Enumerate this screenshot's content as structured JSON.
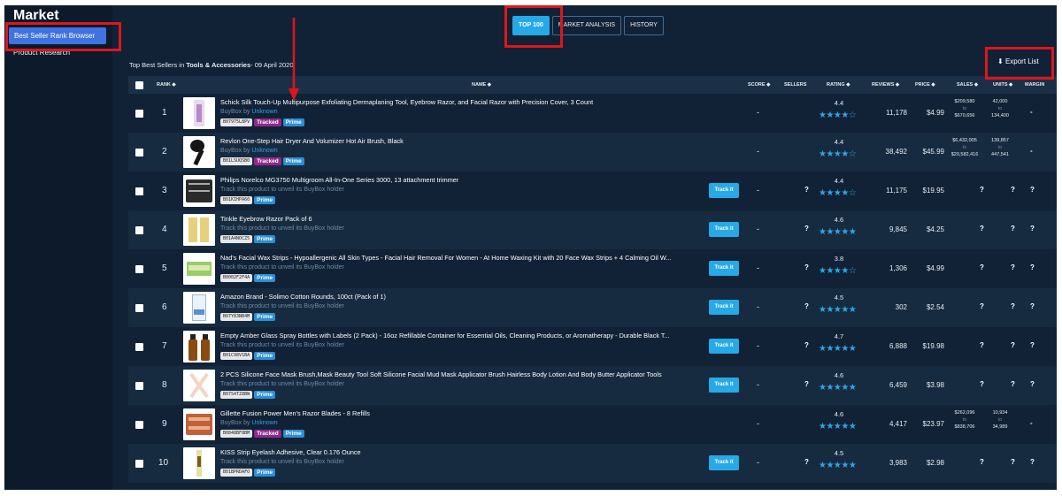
{
  "brand": "Market",
  "sidebar": {
    "items": [
      {
        "label": "Best Seller Rank Browser"
      },
      {
        "label": "Product Research"
      }
    ]
  },
  "tabs": [
    {
      "label": "TOP 100"
    },
    {
      "label": "MARKET ANALYSIS"
    },
    {
      "label": "HISTORY"
    }
  ],
  "subtitle": {
    "prefix": "Top Best Sellers in ",
    "category": "Tools & Accessories",
    "suffix": "- 09 April 2020"
  },
  "export_label": "Export List",
  "columns": {
    "rank": "RANK",
    "name": "NAME",
    "score": "SCORE",
    "sellers": "SELLERS",
    "rating": "RATING",
    "reviews": "REVIEWS",
    "price": "PRICE",
    "sales": "SALES",
    "units": "UNITS",
    "margin": "MARGIN"
  },
  "labels": {
    "buybox": "BuyBox by",
    "unknown": "Unknown",
    "track_hint": "Track this product to unveil its BuyBox holder",
    "tracked": "Tracked",
    "prime": "Prime",
    "track_btn": "Track it",
    "to": "to"
  },
  "rows": [
    {
      "rank": "1",
      "name": "Schick Silk Touch-Up Multipurpose Exfoliating Dermaplaning Tool, Eyebrow Razor, and Facial Razor with Precision Cover, 3 Count",
      "asin": "B07975L8PV",
      "tracked": true,
      "score": "-",
      "sellers": "",
      "rating": "4.4",
      "stars": 4,
      "reviews": "11,178",
      "price": "$4.99",
      "sales_lo": "$209,580",
      "sales_hi": "$670,656",
      "units_lo": "42,000",
      "units_hi": "134,400",
      "margin": "-"
    },
    {
      "rank": "2",
      "name": "Revlon One-Step Hair Dryer And Volumizer Hot Air Brush, Black",
      "asin": "B01LSUQSB0",
      "tracked": true,
      "score": "-",
      "sellers": "",
      "rating": "4.4",
      "stars": 4,
      "reviews": "38,492",
      "price": "$45.99",
      "sales_lo": "$6,432,005",
      "sales_hi": "$20,582,416",
      "units_lo": "139,857",
      "units_hi": "447,541",
      "margin": "-"
    },
    {
      "rank": "3",
      "name": "Philips Norelco MG3750 Multigroom All-In-One Series 3000, 13 attachment trimmer",
      "asin": "B01KIHPA60",
      "tracked": false,
      "score": "-",
      "sellers": "?",
      "rating": "4.4",
      "stars": 4,
      "reviews": "11,175",
      "price": "$19.95",
      "sales_lo": "?",
      "units_lo": "?",
      "margin": "?"
    },
    {
      "rank": "4",
      "name": "Tinkle Eyebrow Razor Pack of 6",
      "asin": "B01A4NOCZ5",
      "tracked": false,
      "score": "-",
      "sellers": "?",
      "rating": "4.6",
      "stars": 4.5,
      "reviews": "9,845",
      "price": "$4.25",
      "sales_lo": "?",
      "units_lo": "?",
      "margin": "?"
    },
    {
      "rank": "5",
      "name": "Nad's Facial Wax Strips - Hypoallergenic All Skin Types - Facial Hair Removal For Women - At Home Waxing Kit with 20 Face Wax Strips + 4 Calming Oil W...",
      "asin": "B0002F2F4A",
      "tracked": false,
      "score": "-",
      "sellers": "?",
      "rating": "3.8",
      "stars": 3.5,
      "reviews": "1,306",
      "price": "$4.99",
      "sales_lo": "?",
      "units_lo": "?",
      "margin": "?"
    },
    {
      "rank": "6",
      "name": "Amazon Brand - Solimo Cotton Rounds, 100ct (Pack of 1)",
      "asin": "B07Y83NB4M",
      "tracked": false,
      "score": "-",
      "sellers": "?",
      "rating": "4.5",
      "stars": 4.5,
      "reviews": "302",
      "price": "$2.54",
      "sales_lo": "?",
      "units_lo": "?",
      "margin": "?"
    },
    {
      "rank": "7",
      "name": "Empty Amber Glass Spray Bottles with Labels (2 Pack) - 16oz Refillable Container for Essential Oils, Cleaning Products, or Aromatherapy - Durable Black T...",
      "asin": "B01C98V1BA",
      "tracked": false,
      "score": "-",
      "sellers": "?",
      "rating": "4.7",
      "stars": 4.5,
      "reviews": "6,888",
      "price": "$19.98",
      "sales_lo": "?",
      "units_lo": "?",
      "margin": "?"
    },
    {
      "rank": "8",
      "name": "2 PCS Silicone Face Mask Brush,Mask Beauty Tool Soft Silicone Facial Mud Mask Applicator Brush Hairless Body Lotion And Body Butter Applicator Tools",
      "asin": "B07S4TZ8BW",
      "tracked": false,
      "score": "-",
      "sellers": "?",
      "rating": "4.6",
      "stars": 4.5,
      "reviews": "6,459",
      "price": "$3.98",
      "sales_lo": "?",
      "units_lo": "?",
      "margin": "?"
    },
    {
      "rank": "9",
      "name": "Gillette Fusion Power Men's Razor Blades - 8 Refills",
      "asin": "B0848BF8BM",
      "tracked": true,
      "score": "-",
      "sellers": "",
      "rating": "4.6",
      "stars": 4.5,
      "reviews": "4,417",
      "price": "$23.97",
      "sales_lo": "$262,096",
      "sales_hi": "$838,706",
      "units_lo": "10,934",
      "units_hi": "34,989",
      "margin": "-"
    },
    {
      "rank": "10",
      "name": "KISS Strip Eyelash Adhesive, Clear 0.176 Ounce",
      "asin": "B01BPRDAFO",
      "tracked": false,
      "score": "-",
      "sellers": "?",
      "rating": "4.5",
      "stars": 4.5,
      "reviews": "3,983",
      "price": "$2.98",
      "sales_lo": "?",
      "units_lo": "?",
      "margin": "?"
    }
  ]
}
